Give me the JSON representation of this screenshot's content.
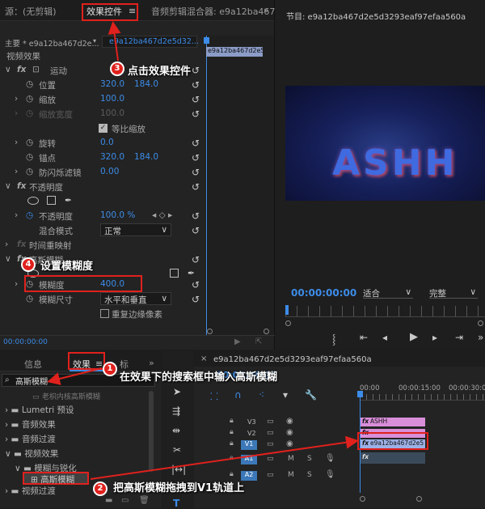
{
  "effect_controls": {
    "tab_source": "源：(无剪辑)",
    "tab_effects": "效果控件",
    "tab_audio_mixer": "音频剪辑混合器: e9a12ba467d",
    "tab_more": "»",
    "master_label": "主要 * e9a12ba467d2e...",
    "clip_label": "e9a12ba467d2e5d32...",
    "timeline_clip": "e9a12ba467d2e5d",
    "section_video": "视频效果",
    "motion": "运动",
    "position": "位置",
    "position_x": "320.0",
    "position_y": "184.0",
    "scale": "缩放",
    "scale_val": "100.0",
    "scale_width": "缩放宽度",
    "scale_width_val": "100.0",
    "uniform_scale": "等比缩放",
    "rotation": "旋转",
    "rotation_val": "0.0",
    "anchor": "锚点",
    "anchor_x": "320.0",
    "anchor_y": "184.0",
    "anti_flicker": "防闪烁滤镜",
    "anti_flicker_val": "0.00",
    "opacity_section": "不透明度",
    "opacity": "不透明度",
    "opacity_val": "100.0 %",
    "blend_mode": "混合模式",
    "blend_val": "正常",
    "time_remap": "时间重映射",
    "gaussian": "高斯模糊",
    "blurriness": "模糊度",
    "blurriness_val": "400.0",
    "blur_dim": "模糊尺寸",
    "blur_dim_val": "水平和垂直",
    "repeat_edge": "重复边缘像素",
    "timecode": "00:00:00:00"
  },
  "program": {
    "title": "节目: e9a12ba467d2e5d3293eaf97efaa560a",
    "timecode": "00:00:00:00",
    "fit": "适合",
    "quality": "完整",
    "preview_text": "ASHH"
  },
  "effects_panel": {
    "tab_info": "信息",
    "tab_effects": "效果",
    "tab_markers": "标",
    "search_value": "高斯模糊",
    "items": [
      {
        "label": "老枳内核高斯模糊"
      },
      {
        "label": "Lumetri 预设"
      },
      {
        "label": "音频效果"
      },
      {
        "label": "音频过渡"
      },
      {
        "label": "视频效果"
      },
      {
        "label": "模糊与锐化"
      },
      {
        "label": "高斯模糊"
      },
      {
        "label": "视频过渡"
      }
    ]
  },
  "timeline": {
    "title": "e9a12ba467d2e5d3293eaf97efaa560a",
    "timecode": "00:00:00:00",
    "ruler": [
      "00:00",
      "00:00:15:00",
      "00:00:30:00"
    ],
    "tracks": [
      "V3",
      "V2",
      "V1",
      "A1",
      "A2"
    ],
    "clip_v3": "ASHH",
    "clip_v1": "e9a12ba467d2e5"
  },
  "annotations": [
    {
      "num": "1",
      "text": "在效果下的搜索框中输入高斯模糊"
    },
    {
      "num": "2",
      "text": "把高斯模糊拖拽到V1轨道上"
    },
    {
      "num": "3",
      "text": "点击效果控件"
    },
    {
      "num": "4",
      "text": "设置模糊度"
    }
  ],
  "colors": {
    "accent_blue": "#3c8ce8",
    "annotation_red": "#e0211d",
    "clip_pink": "#d98ed9",
    "clip_blue": "#9cb0e6"
  }
}
